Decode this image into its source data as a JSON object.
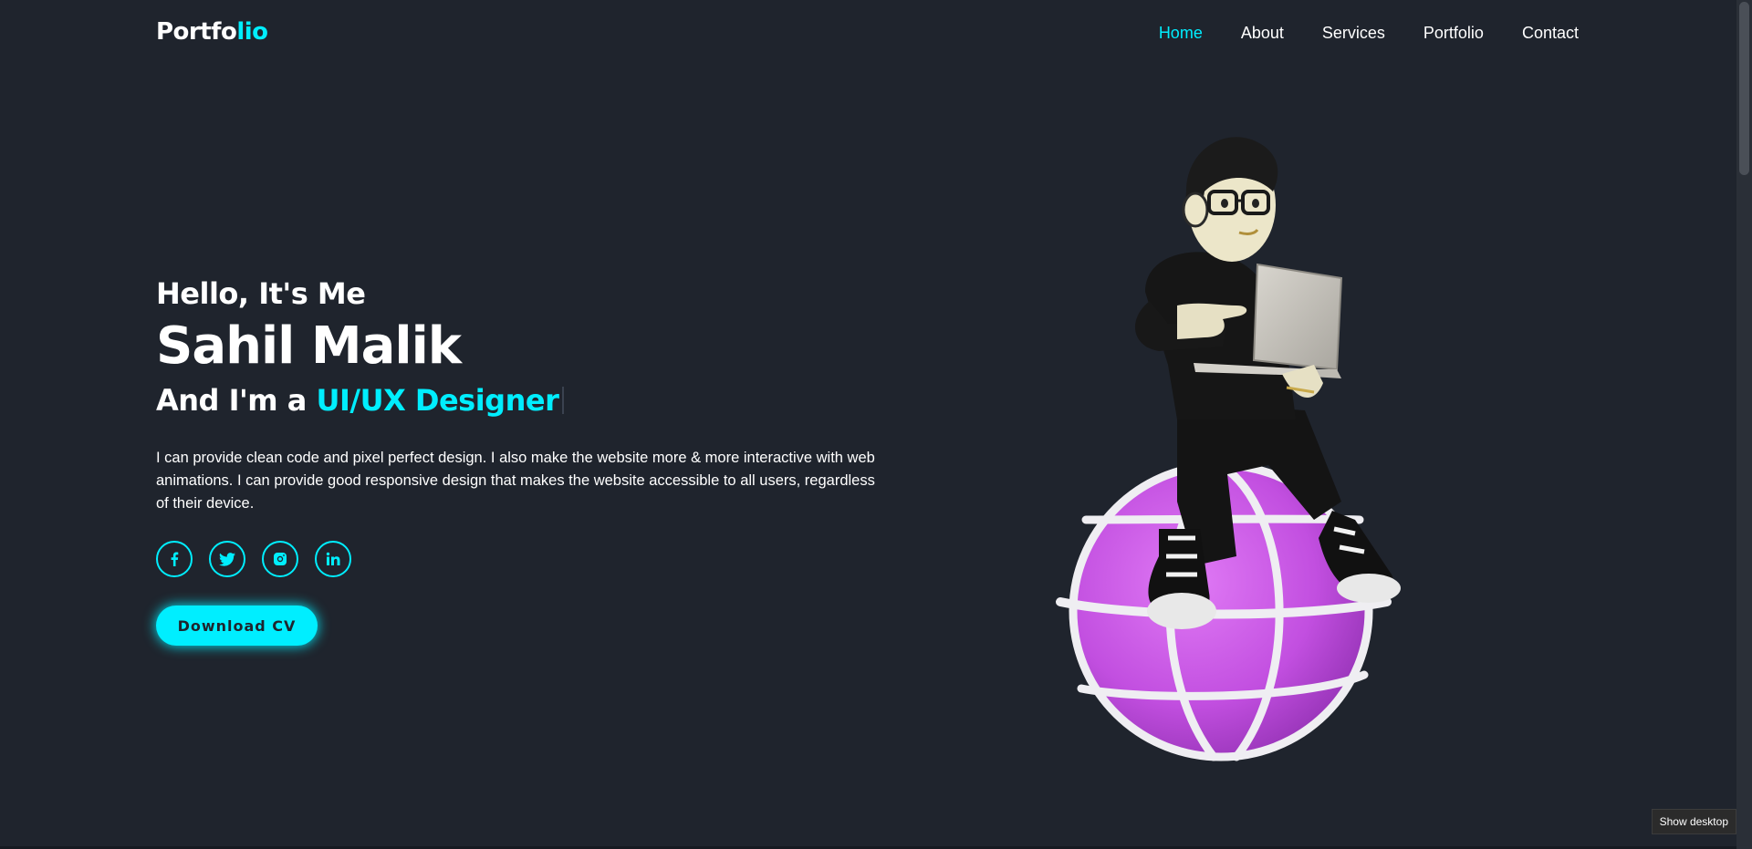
{
  "header": {
    "logo_main": "Portfo",
    "logo_accent": "lio",
    "nav": [
      {
        "label": "Home",
        "active": true
      },
      {
        "label": "About",
        "active": false
      },
      {
        "label": "Services",
        "active": false
      },
      {
        "label": "Portfolio",
        "active": false
      },
      {
        "label": "Contact",
        "active": false
      }
    ]
  },
  "home": {
    "greeting": "Hello, It's Me",
    "name": "Sahil Malik",
    "role_prefix": "And I'm a ",
    "role_accent": "UI/UX Designer",
    "description": "I can provide clean code and pixel perfect design. I also make the website more & more interactive with web animations. I can provide good responsive design that makes the website accessible to all users, regardless of their device.",
    "socials": [
      {
        "icon": "facebook-icon"
      },
      {
        "icon": "twitter-icon"
      },
      {
        "icon": "instagram-icon"
      },
      {
        "icon": "linkedin-icon"
      }
    ],
    "cv_button": "Download CV"
  },
  "taskbar": {
    "show_desktop": "Show desktop"
  },
  "colors": {
    "background": "#1f242d",
    "accent": "#00eeff",
    "text": "#ffffff",
    "globe": "#c44fe0"
  }
}
